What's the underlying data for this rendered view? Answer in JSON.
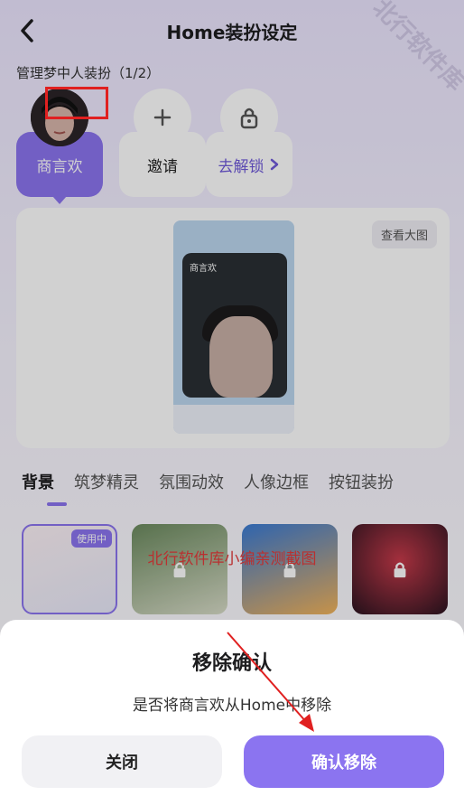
{
  "header": {
    "title": "Home装扮设定"
  },
  "manage_label": "管理梦中人装扮（1/2）",
  "roles": [
    {
      "label": "商言欢"
    },
    {
      "label": "邀请"
    },
    {
      "label": "去解锁"
    }
  ],
  "preview": {
    "view_large": "查看大图",
    "phone_name": "商言欢"
  },
  "tabs": [
    "背景",
    "筑梦精灵",
    "氛围动效",
    "人像边框",
    "按钮装扮"
  ],
  "thumbs": {
    "in_use": "使用中"
  },
  "watermark": {
    "center": "北行软件库小编亲测截图",
    "corner": "北行软件库"
  },
  "dialog": {
    "title": "移除确认",
    "message": "是否将商言欢从Home中移除",
    "close": "关闭",
    "confirm": "确认移除"
  },
  "colors": {
    "accent": "#8b74f0",
    "annotation": "#e02020"
  }
}
